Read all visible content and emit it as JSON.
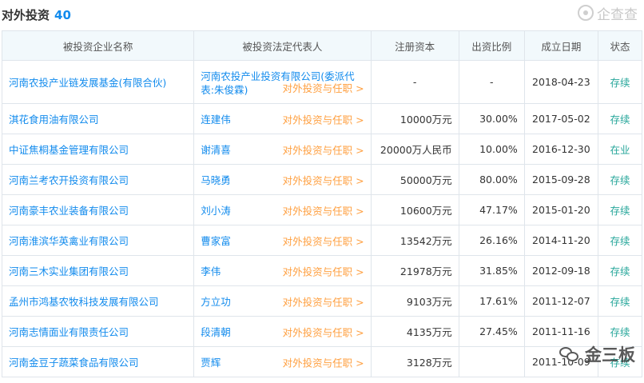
{
  "header": {
    "title": "对外投资",
    "count": "40",
    "brand": "企查查"
  },
  "table": {
    "columns": [
      "被投资企业名称",
      "被投资法定代表人",
      "注册资本",
      "出资比例",
      "成立日期",
      "状态"
    ],
    "rows": [
      {
        "name": "河南农投产业链发展基金(有限合伙)",
        "rep": "河南农投产业投资有限公司(委派代表:朱俊霖)",
        "link": "对外投资与任职 >",
        "capital": "-",
        "ratio": "-",
        "date": "2018-04-23",
        "status": "存续"
      },
      {
        "name": "淇花食用油有限公司",
        "rep": "连建伟",
        "link": "对外投资与任职 >",
        "capital": "10000万元",
        "ratio": "30.00%",
        "date": "2017-05-02",
        "status": "存续"
      },
      {
        "name": "中证焦桐基金管理有限公司",
        "rep": "谢清喜",
        "link": "对外投资与任职 >",
        "capital": "20000万人民币",
        "ratio": "10.00%",
        "date": "2016-12-30",
        "status": "在业"
      },
      {
        "name": "河南兰考农开投资有限公司",
        "rep": "马晓勇",
        "link": "对外投资与任职 >",
        "capital": "50000万元",
        "ratio": "80.00%",
        "date": "2015-09-28",
        "status": "存续"
      },
      {
        "name": "河南豪丰农业装备有限公司",
        "rep": "刘小涛",
        "link": "对外投资与任职 >",
        "capital": "10600万元",
        "ratio": "47.17%",
        "date": "2015-01-20",
        "status": "存续"
      },
      {
        "name": "河南淮滨华英禽业有限公司",
        "rep": "曹家富",
        "link": "对外投资与任职 >",
        "capital": "13542万元",
        "ratio": "26.16%",
        "date": "2014-11-20",
        "status": "存续"
      },
      {
        "name": "河南三木实业集团有限公司",
        "rep": "李伟",
        "link": "对外投资与任职 >",
        "capital": "21978万元",
        "ratio": "31.85%",
        "date": "2012-09-18",
        "status": "存续"
      },
      {
        "name": "孟州市鸿基农牧科技发展有限公司",
        "rep": "方立功",
        "link": "对外投资与任职 >",
        "capital": "9103万元",
        "ratio": "17.61%",
        "date": "2011-12-07",
        "status": "存续"
      },
      {
        "name": "河南志情面业有限责任公司",
        "rep": "段清朝",
        "link": "对外投资与任职 >",
        "capital": "4135万元",
        "ratio": "27.45%",
        "date": "2011-11-16",
        "status": "存续"
      },
      {
        "name": "河南金豆子蔬菜食品有限公司",
        "rep": "贾辉",
        "link": "对外投资与任职 >",
        "capital": "3128万元",
        "ratio": "",
        "date": "2011-10-09",
        "status": "存续"
      }
    ]
  },
  "watermark": {
    "text": "金三板"
  }
}
